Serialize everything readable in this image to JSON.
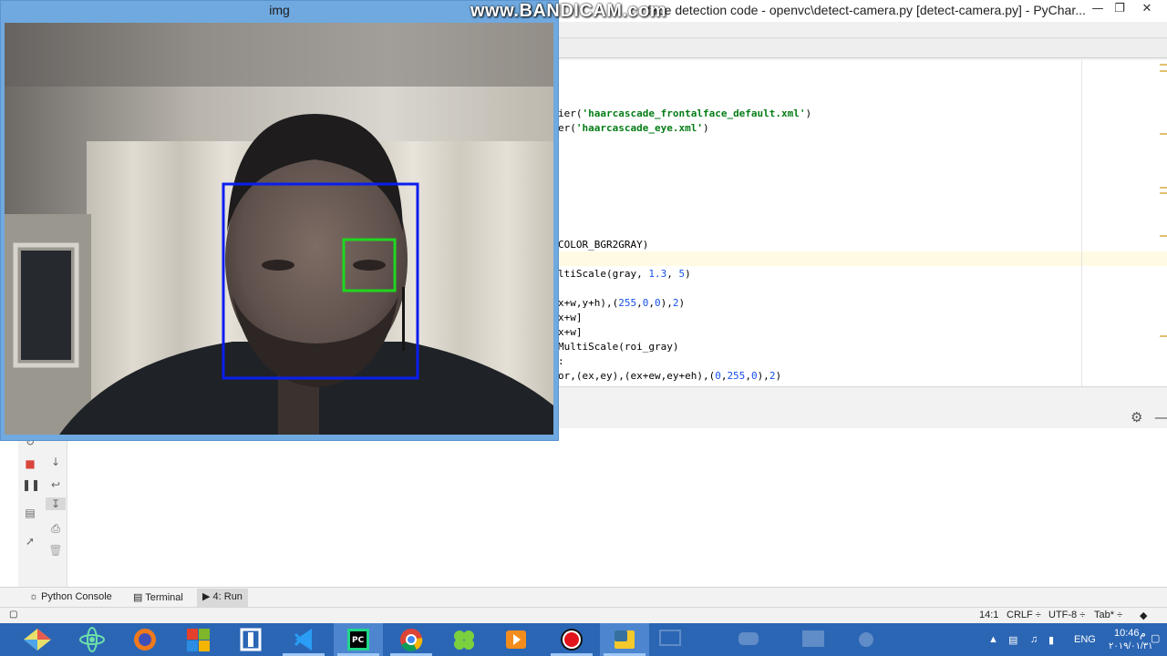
{
  "pycharm": {
    "title": "face detection code - openvc\\detect-camera.py [detect-camera.py] - PyChar...",
    "code_lines": [
      {
        "segments": [
          {
            "t": "ier(",
            "c": ""
          },
          {
            "t": "'haarcascade_frontalface_default.xml'",
            "c": "str"
          },
          {
            "t": ")",
            "c": ""
          }
        ]
      },
      {
        "segments": [
          {
            "t": "er(",
            "c": ""
          },
          {
            "t": "'haarcascade_eye.xml'",
            "c": "str"
          },
          {
            "t": ")",
            "c": ""
          }
        ]
      },
      {
        "segments": [
          {
            "t": "COLOR_BGR2GRAY)",
            "c": ""
          }
        ]
      },
      {
        "segments": [
          {
            "t": "ltiScale(gray, ",
            "c": ""
          },
          {
            "t": "1.3",
            "c": "num"
          },
          {
            "t": ", ",
            "c": ""
          },
          {
            "t": "5",
            "c": "num"
          },
          {
            "t": ")",
            "c": ""
          }
        ]
      },
      {
        "segments": [
          {
            "t": "x+w,y+h),(",
            "c": ""
          },
          {
            "t": "255",
            "c": "num"
          },
          {
            "t": ",",
            "c": ""
          },
          {
            "t": "0",
            "c": "num"
          },
          {
            "t": ",",
            "c": ""
          },
          {
            "t": "0",
            "c": "num"
          },
          {
            "t": "),",
            "c": ""
          },
          {
            "t": "2",
            "c": "num"
          },
          {
            "t": ")",
            "c": ""
          }
        ]
      },
      {
        "segments": [
          {
            "t": "x+w]",
            "c": ""
          }
        ]
      },
      {
        "segments": [
          {
            "t": "x+w]",
            "c": ""
          }
        ]
      },
      {
        "segments": [
          {
            "t": "MultiScale(roi_gray)",
            "c": ""
          }
        ]
      },
      {
        "segments": [
          {
            "t": ":",
            "c": ""
          }
        ]
      },
      {
        "segments": [
          {
            "t": "or,(ex,ey),(ex+ew,ey+eh),(",
            "c": ""
          },
          {
            "t": "0",
            "c": "num"
          },
          {
            "t": ",",
            "c": ""
          },
          {
            "t": "255",
            "c": "num"
          },
          {
            "t": ",",
            "c": ""
          },
          {
            "t": "0",
            "c": "num"
          },
          {
            "t": "),",
            "c": ""
          },
          {
            "t": "2",
            "c": "num"
          },
          {
            "t": ")",
            "c": ""
          }
        ]
      }
    ],
    "bottom_tabs": [
      "Python Console",
      "Terminal",
      "4: Run"
    ],
    "status": {
      "position": "14:1",
      "line_sep": "CRLF ÷",
      "encoding": "UTF-8 ÷",
      "indent": "Tab* ÷"
    }
  },
  "img_window": {
    "title": "img"
  },
  "watermark": "www.BANDICAM.com",
  "taskbar": {
    "apps": [
      "windows-store",
      "atom",
      "firefox",
      "office",
      "sublime",
      "vscode",
      "pycharm",
      "chrome",
      "clover",
      "media-player",
      "bandicam-record",
      "python"
    ],
    "lang": "ENG",
    "time": "10:46",
    "date": "٢٠١٩/٠١/٣١",
    "period": "م"
  },
  "colors": {
    "face_box": "#0a1ef0",
    "eye_box": "#1fd61f",
    "accent": "#2b66b5"
  }
}
